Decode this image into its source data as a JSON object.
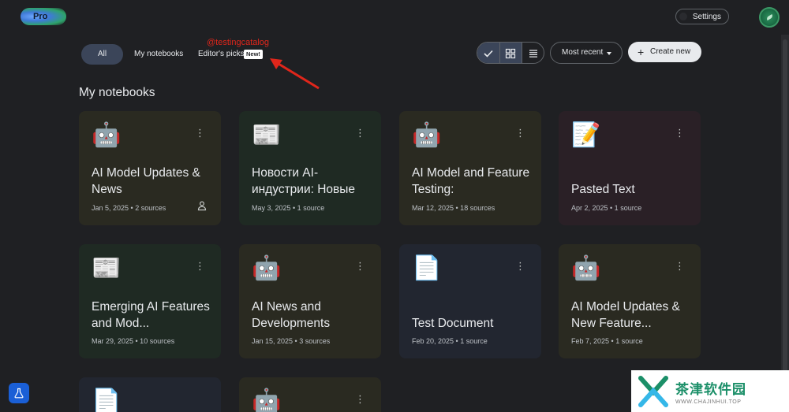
{
  "header": {
    "logo_text": "Pro",
    "settings_label": "Settings"
  },
  "filters": {
    "all": "All",
    "my_notebooks": "My notebooks",
    "editors_picks": "Editor's picks",
    "new_badge": "New!"
  },
  "annotation": {
    "watermark": "@testingcatalog"
  },
  "toolbar": {
    "sort_label": "Most recent",
    "create_label": "Create new"
  },
  "section_title": "My notebooks",
  "notebooks": [
    {
      "emoji": "🤖",
      "title": "AI Model Updates & News",
      "meta": "Jan 5, 2025 • 2 sources",
      "shared": true
    },
    {
      "emoji": "📰",
      "title": "Новости AI-индустрии: Новые",
      "meta": "May 3, 2025 • 1 source",
      "shared": false
    },
    {
      "emoji": "🤖",
      "title": "AI Model and Feature Testing:",
      "meta": "Mar 12, 2025 • 18 sources",
      "shared": false
    },
    {
      "emoji": "📝",
      "title": "Pasted Text",
      "meta": "Apr 2, 2025 • 1 source",
      "shared": false
    },
    {
      "emoji": "📰",
      "title": "Emerging AI Features and Mod...",
      "meta": "Mar 29, 2025 • 10 sources",
      "shared": false
    },
    {
      "emoji": "🤖",
      "title": "AI News and Developments",
      "meta": "Jan 15, 2025 • 3 sources",
      "shared": false
    },
    {
      "emoji": "📄",
      "title": "Test Document",
      "meta": "Feb 20, 2025 • 1 source",
      "shared": false
    },
    {
      "emoji": "🤖",
      "title": "AI Model Updates & New Feature...",
      "meta": "Feb 7, 2025 • 1 source",
      "shared": false
    },
    {
      "emoji": "📄",
      "title": "",
      "meta": "",
      "shared": false
    },
    {
      "emoji": "🤖",
      "title": "",
      "meta": "",
      "shared": false
    }
  ],
  "corner_watermark": {
    "line1": "茶津软件园",
    "line2": "WWW.CHAJINHUI.TOP"
  },
  "colors": {
    "background": "#1f2023",
    "accent_active": "#3b4559",
    "annotation_red": "#e0261b"
  }
}
